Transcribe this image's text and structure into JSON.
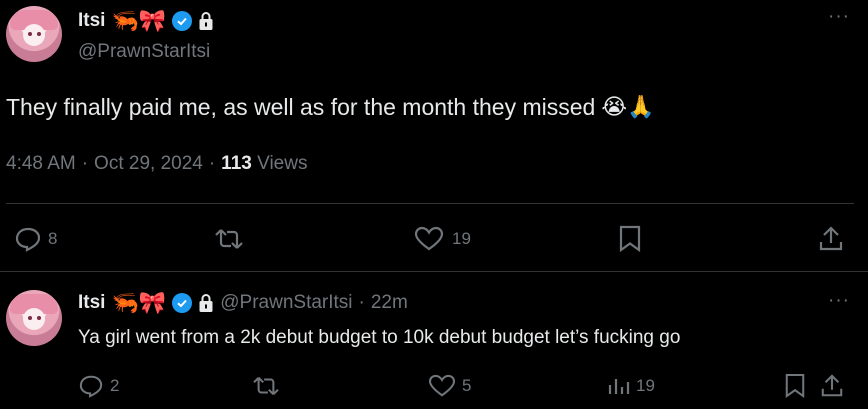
{
  "tweet": {
    "author_name": "Itsi",
    "name_emojis": "🦐🎀",
    "handle": "@PrawnStarItsi",
    "text": "They finally paid me, as well as for the month they missed",
    "text_emojis": "😭🙏",
    "time": "4:48 AM",
    "date": "Oct 29, 2024",
    "views_count": "113",
    "views_label": "Views",
    "separator": "·",
    "replies": "8",
    "likes": "19",
    "more_label": "···"
  },
  "reply": {
    "author_name": "Itsi",
    "name_emojis": "🦐🎀",
    "handle": "@PrawnStarItsi",
    "separator": "·",
    "age": "22m",
    "text": "Ya girl went from a 2k debut budget to 10k debut budget let’s fucking go",
    "replies": "2",
    "likes": "5",
    "views": "19",
    "more_label": "···"
  },
  "colors": {
    "background": "#000000",
    "text": "#e7e9ea",
    "muted": "#71767b",
    "divider": "#2f3336",
    "verified": "#1d9bf0"
  }
}
